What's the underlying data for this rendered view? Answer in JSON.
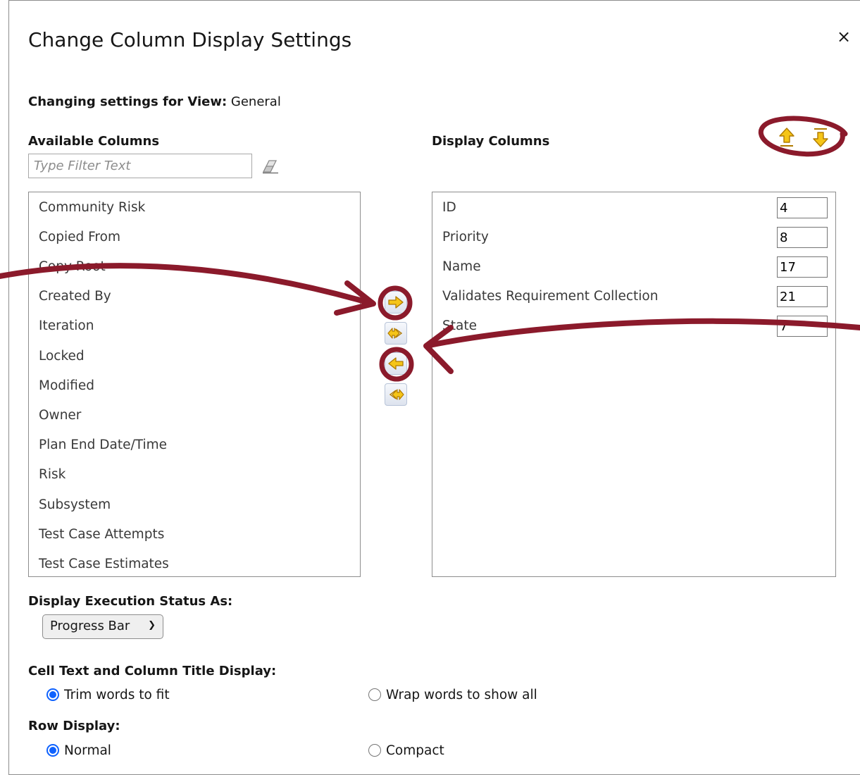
{
  "dialog": {
    "title": "Change Column Display Settings",
    "close": "×",
    "view_label": "Changing settings for View:",
    "view_name": "General"
  },
  "available": {
    "header": "Available Columns",
    "filter_placeholder": "Type Filter Text",
    "items": [
      "Community Risk",
      "Copied From",
      "Copy Root",
      "Created By",
      "Iteration",
      "Locked",
      "Modified",
      "Owner",
      "Plan End Date/Time",
      "Risk",
      "Subsystem",
      "Test Case Attempts",
      "Test Case Estimates"
    ]
  },
  "display": {
    "header": "Display Columns",
    "items": [
      {
        "label": "ID",
        "width": "4"
      },
      {
        "label": "Priority",
        "width": "8"
      },
      {
        "label": "Name",
        "width": "17"
      },
      {
        "label": "Validates Requirement Collection",
        "width": "21"
      },
      {
        "label": "State",
        "width": "7"
      }
    ]
  },
  "icons": {
    "eraser": "eraser-icon",
    "move_up": "move-up-icon",
    "move_down": "move-down-icon",
    "add": "arrow-right-icon",
    "add_all": "double-arrow-right-icon",
    "remove": "arrow-left-icon",
    "remove_all": "double-arrow-left-icon"
  },
  "execution_status": {
    "label": "Display Execution Status As:",
    "selected": "Progress Bar"
  },
  "cell_text": {
    "label": "Cell Text and Column Title Display:",
    "options": [
      "Trim words to fit",
      "Wrap words to show all"
    ],
    "selected": "Trim words to fit"
  },
  "row_display": {
    "label": "Row Display:",
    "options": [
      "Normal",
      "Compact"
    ],
    "selected": "Normal"
  },
  "colors": {
    "accent": "#0f62fe",
    "annotation": "#8b1a2b",
    "arrow_fill": "#f5c518"
  }
}
